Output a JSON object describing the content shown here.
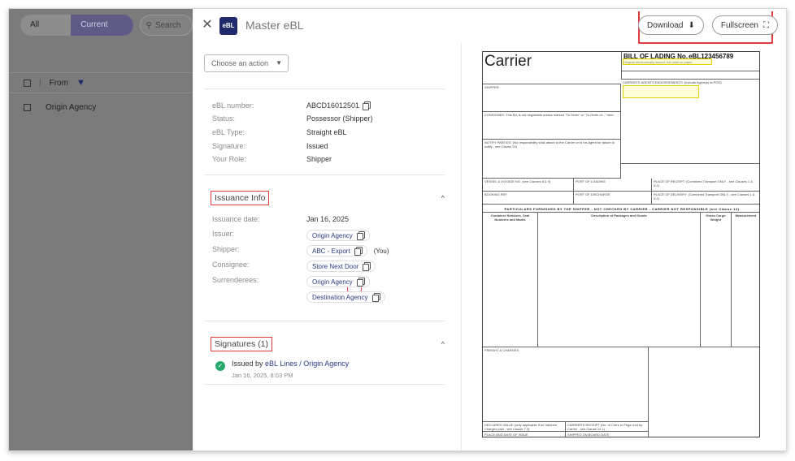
{
  "background_app": {
    "tabs": [
      "All folders",
      "Current folder"
    ],
    "search_placeholder": "Search",
    "table_header": {
      "column_label": "From"
    },
    "rows": [
      {
        "from": "Origin Agency"
      }
    ]
  },
  "drawer": {
    "title": "Master eBL",
    "logo_text": "eBL",
    "download_label": "Download",
    "fullscreen_label": "Fullscreen",
    "action_select": {
      "placeholder": "Choose an action"
    },
    "summary": [
      {
        "label": "eBL number:",
        "value": "ABCD16012501"
      },
      {
        "label": "Status:",
        "value": "Possessor (Shipper)"
      },
      {
        "label": "eBL Type:",
        "value": "Straight eBL"
      },
      {
        "label": "Signature:",
        "value": "Issued"
      },
      {
        "label": "Your Role:",
        "value": "Shipper"
      }
    ],
    "issuance": {
      "title": "Issuance Info",
      "issuance_date_label": "Issuance date:",
      "issuance_date": "Jan 16, 2025",
      "issuer_label": "Issuer:",
      "issuer": "Origin Agency",
      "shipper_label": "Shipper:",
      "shipper": "ABC - Export",
      "shipper_note": "(You)",
      "consignee_label": "Consignee:",
      "consignee": "Store Next Door",
      "surrenderees_label": "Surrenderees:",
      "surrenderees": [
        "Origin Agency",
        "Destination Agency"
      ]
    },
    "signatures": {
      "title": "Signatures (1)",
      "issued_by_prefix": "Issued by",
      "issued_by": "eBL Lines / Origin Agency",
      "date": "Jan 16, 2025, 8:03 PM"
    }
  },
  "document": {
    "carrier": "Carrier",
    "bl_title": "BILL OF LADING No.",
    "bl_number": "eBL123456789",
    "original_note": "Original electronically issued, not valid on paper",
    "shipper_label": "SHIPPER:",
    "consignee_label": "CONSIGNEE: This B/L is not negotiable unless marked \"To Order\" or \"To Order of...\" here.",
    "notify_label": "NOTIFY PARTIES: (No responsibility shall attach to the Carrier or to his Agent for failure to notify - see Clause 20)",
    "endorsements_label": "CARRIER'S AGENTS ENDORSEMENTS: (Include Agent(s) at POD)",
    "vessel_label": "VESSEL & VOYAGE NO. (see Clauses 8 & 9)",
    "port_loading_label": "PORT OF LOADING",
    "place_receipt_label": "PLACE OF RECEIPT: (Combined Transport ONLY - see Clauses 1 & 5.2)",
    "booking_label": "BOOKING REF.",
    "port_discharge_label": "PORT OF DISCHARGE",
    "place_delivery_label": "PLACE OF DELIVERY: (Combined Transport ONLY - see Clauses 1 & 5.2)",
    "particulars_banner": "PARTICULARS FURNISHED BY THE SHIPPER - NOT CHECKED BY CARRIER - CARRIER NOT RESPONSIBLE (see Clause 14)",
    "col_container": "Container Numbers, Seal Numbers and Marks",
    "col_description": "Description of Packages and Goods",
    "col_weight": "Gross Cargo Weight",
    "col_measurement": "Measurement",
    "freight_label": "FREIGHT & CHARGES",
    "declared_label": "DECLARED VALUE (only applicable if Ad Valorem Charges paid - see Clause 7.3)",
    "receipt_label": "CARRIER'S RECEIPT (No. of Cntrs or Pkgs rcvd by Carrier - see Clause 14.1)",
    "place_issue_label": "PLACE AND DATE OF ISSUE",
    "shipped_label": "SHIPPED ON BOARD DATE"
  }
}
